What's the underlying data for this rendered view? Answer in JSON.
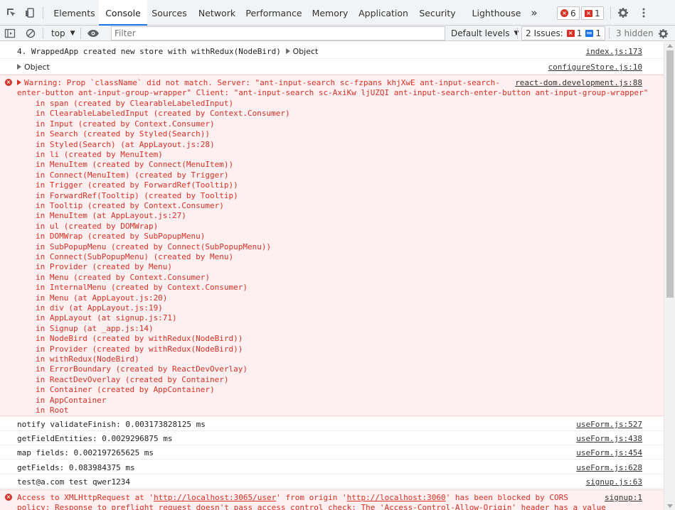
{
  "toolbar": {
    "tabs": [
      {
        "label": "Elements"
      },
      {
        "label": "Console",
        "active": true
      },
      {
        "label": "Sources"
      },
      {
        "label": "Network"
      },
      {
        "label": "Performance"
      },
      {
        "label": "Memory"
      },
      {
        "label": "Application"
      },
      {
        "label": "Security"
      },
      {
        "label": "Lighthouse"
      }
    ],
    "more_tabs": "»",
    "error_count": "6",
    "warning_count": "1",
    "settings_icon": "gear-icon",
    "menu_icon": "kebab-icon"
  },
  "filterbar": {
    "context": "top",
    "filter_placeholder": "Filter",
    "levels": "Default levels",
    "issues_label": "2 Issues:",
    "issues_err": "1",
    "issues_info": "1",
    "hidden": "3 hidden"
  },
  "console": {
    "row1": {
      "text": "4. WrappedApp created new store with withRedux(NodeBird)",
      "obj": "Object",
      "src": "index.js:173"
    },
    "row2": {
      "obj": "Object",
      "src": "configureStore.js:10"
    },
    "warning": {
      "line1": "Warning: Prop `className` did not match. Server: \"ant-input-search sc-fzpans khjXwE ant-input-search-",
      "line2": "enter-button ant-input-group-wrapper\" Client: \"ant-input-search sc-AxiKw ljUZQI ant-input-search-enter-button ant-input-group-wrapper\"",
      "src": "react-dom.development.js:88",
      "stack": [
        "in span (created by ClearableLabeledInput)",
        "in ClearableLabeledInput (created by Context.Consumer)",
        "in Input (created by Context.Consumer)",
        "in Search (created by Styled(Search))",
        "in Styled(Search) (at AppLayout.js:28)",
        "in li (created by MenuItem)",
        "in MenuItem (created by Connect(MenuItem))",
        "in Connect(MenuItem) (created by Trigger)",
        "in Trigger (created by ForwardRef(Tooltip))",
        "in ForwardRef(Tooltip) (created by Tooltip)",
        "in Tooltip (created by Context.Consumer)",
        "in MenuItem (at AppLayout.js:27)",
        "in ul (created by DOMWrap)",
        "in DOMWrap (created by SubPopupMenu)",
        "in SubPopupMenu (created by Connect(SubPopupMenu))",
        "in Connect(SubPopupMenu) (created by Menu)",
        "in Provider (created by Menu)",
        "in Menu (created by Context.Consumer)",
        "in InternalMenu (created by Context.Consumer)",
        "in Menu (at AppLayout.js:20)",
        "in div (at AppLayout.js:19)",
        "in AppLayout (at signup.js:71)",
        "in Signup (at _app.js:14)",
        "in NodeBird (created by withRedux(NodeBird))",
        "in Provider (created by withRedux(NodeBird))",
        "in withRedux(NodeBird)",
        "in ErrorBoundary (created by ReactDevOverlay)",
        "in ReactDevOverlay (created by Container)",
        "in Container (created by AppContainer)",
        "in AppContainer",
        "in Root"
      ]
    },
    "logs": [
      {
        "text": "notify validateFinish: 0.003173828125 ms",
        "src": "useForm.js:527"
      },
      {
        "text": "getFieldEntities: 0.0029296875 ms",
        "src": "useForm.js:438"
      },
      {
        "text": "map fields: 0.002197265625 ms",
        "src": "useForm.js:454"
      },
      {
        "text": "getFields: 0.083984375 ms",
        "src": "useForm.js:628"
      },
      {
        "text": "test@a.com test qwer1234",
        "src": "signup.js:63"
      }
    ],
    "cors": {
      "pre": "Access to XMLHttpRequest at '",
      "url1": "http://localhost:3065/user",
      "mid": "' from origin '",
      "url2": "http://localhost:3060",
      "post": "' has been blocked by CORS",
      "line2": "policy: Response to preflight request doesn't pass access control check: The 'Access-Control-Allow-Origin' header has a value",
      "src": "signup:1"
    }
  }
}
